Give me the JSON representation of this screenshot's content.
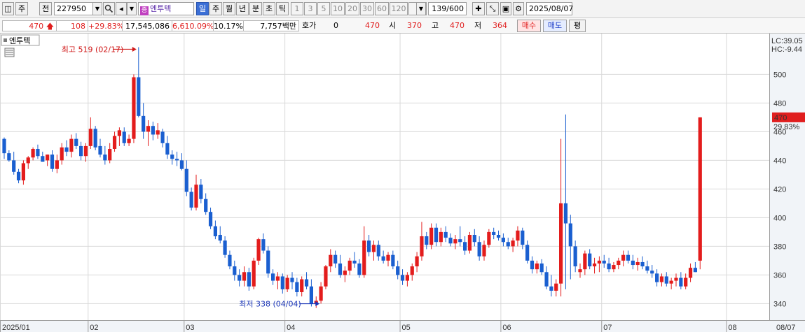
{
  "toolbar": {
    "period_label": "주",
    "prev_label": "전",
    "code": "227950",
    "stock_name": "엔투텍",
    "stock_badge": "증",
    "timeframes": [
      "일",
      "주",
      "월",
      "년",
      "분",
      "초",
      "틱"
    ],
    "selected_timeframe": "일",
    "intervals": [
      "1",
      "3",
      "5",
      "10",
      "20",
      "30",
      "60",
      "120"
    ],
    "count": "139/600",
    "date": "2025/08/07"
  },
  "quote": {
    "price": "470",
    "change": "108",
    "change_pct": "+29.83%",
    "volume": "17,545,086",
    "volume_ratio": "6,610.09%",
    "turnover": "10.17%",
    "amount": "7,757백만",
    "hoga_label": "호가",
    "hoga_value": "0",
    "hoga_price": "470",
    "open_label": "시",
    "open": "370",
    "high_label": "고",
    "high": "470",
    "low_label": "저",
    "low": "364",
    "buy_label": "매수",
    "sell_label": "매도",
    "eval_label": "평"
  },
  "chart_data": {
    "type": "candlestick",
    "title": "엔투텍",
    "ylim": [
      333,
      521
    ],
    "yticks": [
      340,
      360,
      380,
      400,
      420,
      440,
      460,
      480,
      500
    ],
    "xticks": [
      {
        "label": "2025/01",
        "index": 0
      },
      {
        "label": "02",
        "index": 18
      },
      {
        "label": "03",
        "index": 38
      },
      {
        "label": "04",
        "index": 59
      },
      {
        "label": "05",
        "index": 83
      },
      {
        "label": "06",
        "index": 104
      },
      {
        "label": "07",
        "index": 125
      },
      {
        "label": "08",
        "index": 151
      },
      {
        "label": "08/07",
        "index": 155
      }
    ],
    "last_price_label": "470",
    "last_change_label": "29.83%",
    "lc_label": "LC:39.05",
    "hc_label": "HC:-9.44",
    "high_annotation": "최고 519 (02/17)",
    "low_annotation": "최저 338 (04/04)",
    "candles": [
      [
        455,
        456,
        441,
        445
      ],
      [
        445,
        447,
        439,
        440
      ],
      [
        440,
        446,
        430,
        432
      ],
      [
        432,
        434,
        424,
        426
      ],
      [
        426,
        440,
        423,
        438
      ],
      [
        438,
        443,
        434,
        442
      ],
      [
        442,
        449,
        440,
        448
      ],
      [
        448,
        451,
        441,
        443
      ],
      [
        443,
        446,
        439,
        439
      ],
      [
        440,
        444,
        436,
        444
      ],
      [
        444,
        447,
        432,
        434
      ],
      [
        434,
        444,
        431,
        440
      ],
      [
        440,
        452,
        437,
        449
      ],
      [
        449,
        454,
        443,
        446
      ],
      [
        446,
        458,
        442,
        455
      ],
      [
        455,
        459,
        448,
        450
      ],
      [
        450,
        453,
        440,
        443
      ],
      [
        443,
        452,
        439,
        450
      ],
      [
        450,
        470,
        448,
        462
      ],
      [
        462,
        464,
        447,
        449
      ],
      [
        450,
        455,
        442,
        444
      ],
      [
        444,
        450,
        437,
        440
      ],
      [
        440,
        452,
        438,
        448
      ],
      [
        448,
        460,
        446,
        457
      ],
      [
        457,
        463,
        450,
        461
      ],
      [
        460,
        463,
        450,
        452
      ],
      [
        452,
        458,
        450,
        455
      ],
      [
        455,
        500,
        452,
        498
      ],
      [
        498,
        519,
        470,
        471
      ],
      [
        471,
        480,
        455,
        460
      ],
      [
        460,
        468,
        450,
        464
      ],
      [
        464,
        467,
        454,
        458
      ],
      [
        458,
        466,
        455,
        461
      ],
      [
        460,
        462,
        449,
        452
      ],
      [
        452,
        457,
        441,
        444
      ],
      [
        444,
        447,
        437,
        441
      ],
      [
        441,
        446,
        436,
        440
      ],
      [
        440,
        445,
        433,
        434
      ],
      [
        434,
        440,
        415,
        418
      ],
      [
        418,
        421,
        405,
        407
      ],
      [
        407,
        430,
        405,
        423
      ],
      [
        423,
        427,
        410,
        413
      ],
      [
        413,
        417,
        402,
        404
      ],
      [
        404,
        407,
        392,
        394
      ],
      [
        394,
        398,
        385,
        387
      ],
      [
        388,
        394,
        382,
        384
      ],
      [
        384,
        387,
        372,
        374
      ],
      [
        374,
        377,
        364,
        366
      ],
      [
        366,
        370,
        356,
        360
      ],
      [
        360,
        364,
        352,
        356
      ],
      [
        356,
        366,
        352,
        362
      ],
      [
        362,
        365,
        349,
        352
      ],
      [
        352,
        372,
        350,
        370
      ],
      [
        370,
        386,
        367,
        385
      ],
      [
        385,
        389,
        375,
        377
      ],
      [
        377,
        380,
        358,
        361
      ],
      [
        361,
        364,
        353,
        356
      ],
      [
        356,
        362,
        350,
        359
      ],
      [
        359,
        361,
        347,
        350
      ],
      [
        350,
        360,
        348,
        358
      ],
      [
        358,
        362,
        350,
        355
      ],
      [
        355,
        358,
        345,
        348
      ],
      [
        348,
        359,
        345,
        357
      ],
      [
        357,
        362,
        350,
        352
      ],
      [
        352,
        357,
        338,
        340
      ],
      [
        340,
        345,
        337,
        342
      ],
      [
        342,
        355,
        340,
        352
      ],
      [
        352,
        367,
        350,
        366
      ],
      [
        366,
        378,
        362,
        374
      ],
      [
        374,
        377,
        365,
        368
      ],
      [
        368,
        374,
        358,
        360
      ],
      [
        360,
        366,
        355,
        363
      ],
      [
        363,
        372,
        360,
        370
      ],
      [
        370,
        376,
        365,
        368
      ],
      [
        368,
        371,
        358,
        360
      ],
      [
        360,
        394,
        358,
        384
      ],
      [
        384,
        388,
        373,
        376
      ],
      [
        376,
        384,
        370,
        381
      ],
      [
        381,
        384,
        370,
        373
      ],
      [
        373,
        377,
        368,
        370
      ],
      [
        370,
        376,
        366,
        374
      ],
      [
        374,
        377,
        364,
        366
      ],
      [
        366,
        370,
        357,
        360
      ],
      [
        360,
        364,
        353,
        356
      ],
      [
        356,
        362,
        352,
        360
      ],
      [
        360,
        368,
        356,
        366
      ],
      [
        366,
        376,
        362,
        373
      ],
      [
        373,
        397,
        370,
        387
      ],
      [
        387,
        390,
        378,
        381
      ],
      [
        381,
        396,
        378,
        393
      ],
      [
        393,
        396,
        380,
        383
      ],
      [
        383,
        393,
        380,
        390
      ],
      [
        390,
        394,
        383,
        386
      ],
      [
        386,
        389,
        380,
        382
      ],
      [
        382,
        388,
        378,
        385
      ],
      [
        385,
        394,
        380,
        383
      ],
      [
        383,
        387,
        374,
        377
      ],
      [
        377,
        390,
        375,
        388
      ],
      [
        388,
        392,
        380,
        383
      ],
      [
        383,
        387,
        370,
        373
      ],
      [
        373,
        384,
        370,
        381
      ],
      [
        381,
        392,
        379,
        390
      ],
      [
        390,
        393,
        385,
        388
      ],
      [
        388,
        391,
        384,
        386
      ],
      [
        386,
        389,
        380,
        383
      ],
      [
        383,
        386,
        378,
        380
      ],
      [
        380,
        386,
        376,
        384
      ],
      [
        384,
        394,
        380,
        391
      ],
      [
        391,
        393,
        378,
        381
      ],
      [
        381,
        384,
        368,
        370
      ],
      [
        370,
        373,
        361,
        364
      ],
      [
        364,
        370,
        361,
        368
      ],
      [
        368,
        371,
        360,
        362
      ],
      [
        362,
        366,
        350,
        352
      ],
      [
        352,
        360,
        345,
        349
      ],
      [
        349,
        357,
        345,
        354
      ],
      [
        354,
        455,
        345,
        410
      ],
      [
        410,
        472,
        350,
        396
      ],
      [
        396,
        402,
        357,
        380
      ],
      [
        380,
        384,
        362,
        366
      ],
      [
        362,
        368,
        358,
        364
      ],
      [
        364,
        377,
        360,
        375
      ],
      [
        375,
        378,
        364,
        366
      ],
      [
        366,
        372,
        361,
        368
      ],
      [
        368,
        373,
        362,
        370
      ],
      [
        370,
        374,
        365,
        368
      ],
      [
        368,
        372,
        362,
        364
      ],
      [
        364,
        369,
        362,
        367
      ],
      [
        367,
        372,
        364,
        370
      ],
      [
        370,
        377,
        366,
        374
      ],
      [
        374,
        377,
        368,
        370
      ],
      [
        370,
        374,
        364,
        367
      ],
      [
        367,
        372,
        363,
        369
      ],
      [
        369,
        373,
        364,
        366
      ],
      [
        366,
        370,
        361,
        363
      ],
      [
        363,
        367,
        358,
        361
      ],
      [
        361,
        364,
        352,
        355
      ],
      [
        355,
        361,
        352,
        359
      ],
      [
        359,
        362,
        352,
        354
      ],
      [
        354,
        358,
        350,
        356
      ],
      [
        356,
        361,
        352,
        358
      ],
      [
        358,
        362,
        350,
        352
      ],
      [
        352,
        361,
        350,
        358
      ],
      [
        358,
        368,
        355,
        365
      ],
      [
        365,
        369,
        362,
        362
      ],
      [
        370,
        470,
        364,
        470
      ]
    ]
  }
}
